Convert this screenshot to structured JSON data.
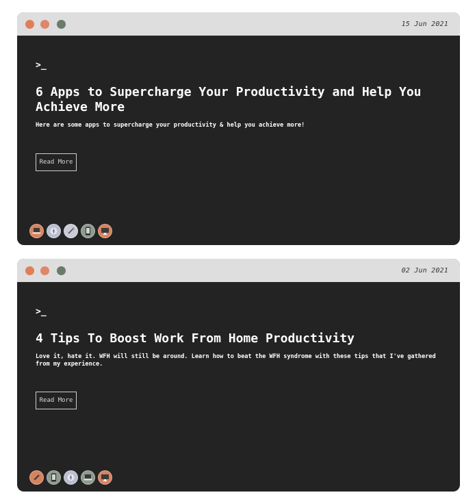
{
  "colors": {
    "card_bg": "#232323",
    "titlebar_bg": "#dedede",
    "dot_red": "#e07e5a",
    "dot_orange": "#e0866a",
    "dot_green": "#6b7b6b"
  },
  "posts": [
    {
      "date": "15 Jun 2021",
      "prompt": ">_",
      "title": "6 Apps to Supercharge Your Productivity and Help You Achieve More",
      "description": "Here are some apps to supercharge your productivity & help you achieve more!",
      "button_label": "Read More",
      "icons": [
        "laptop-icon",
        "compass-icon",
        "rocket-icon",
        "phone-icon",
        "monitor-icon"
      ]
    },
    {
      "date": "02 Jun 2021",
      "prompt": ">_",
      "title": "4 Tips To Boost Work From Home Productivity",
      "description": "Love it, hate it. WFH will still be around. Learn how to beat the WFH syndrome with these tips that I've gathered from my experience.",
      "button_label": "Read More",
      "icons": [
        "pencil-icon",
        "phone-icon",
        "compass-icon",
        "laptop-icon",
        "monitor-icon"
      ]
    }
  ]
}
